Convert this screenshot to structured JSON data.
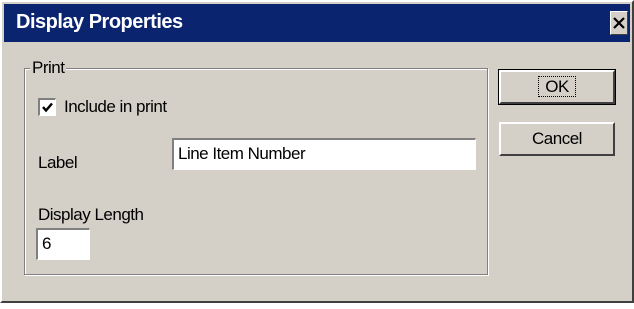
{
  "window": {
    "title": "Display Properties"
  },
  "group": {
    "legend": "Print"
  },
  "include_in_print": {
    "label": "Include in print",
    "checked": true
  },
  "label_field": {
    "label": "Label",
    "value": "Line Item Number"
  },
  "display_length": {
    "label": "Display Length",
    "value": "6"
  },
  "buttons": {
    "ok_label": "OK",
    "cancel_label": "Cancel"
  },
  "colors": {
    "titlebar": "#0a2470",
    "dialog_face": "#d4d0c8"
  },
  "icons": {
    "close": "close-icon",
    "checkmark": "checkmark-icon"
  }
}
